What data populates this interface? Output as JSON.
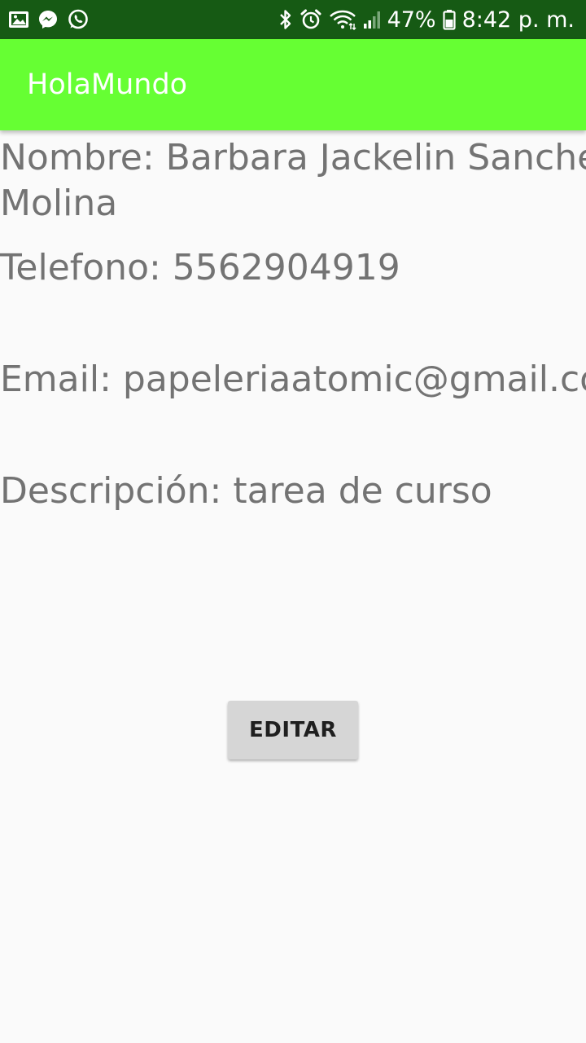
{
  "status_bar": {
    "left_icons": [
      "gallery-icon",
      "messenger-icon",
      "whatsapp-icon"
    ],
    "right_icons": [
      "bluetooth-icon",
      "alarm-icon",
      "wifi-icon",
      "signal-icon",
      "battery-icon"
    ],
    "battery": "47%",
    "time": "8:42 p. m."
  },
  "app_bar": {
    "title": "HolaMundo",
    "color": "#66ff33"
  },
  "contact": {
    "name_line1": "Nombre: Barbara Jackelin Sanchez",
    "name_line2": "Molina",
    "phone": "Telefono: 5562904919",
    "email": "Email: papeleriaatomic@gmail.com",
    "description": "Descripción: tarea de curso"
  },
  "actions": {
    "edit_label": "EDITAR"
  }
}
